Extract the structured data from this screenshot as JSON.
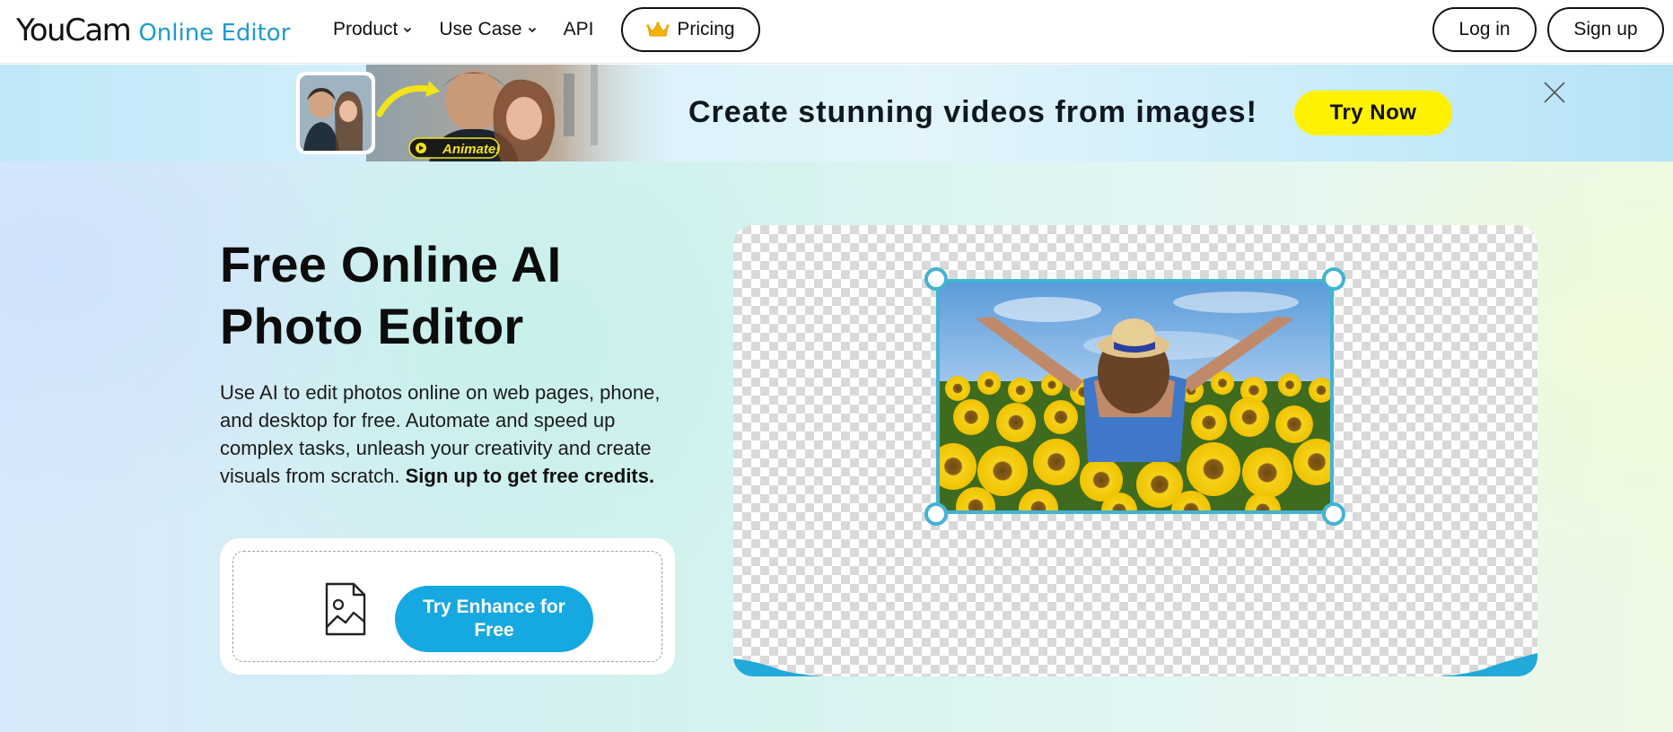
{
  "nav": {
    "logo_main": "YouCam",
    "logo_sub": "Online Editor",
    "menu": [
      {
        "label": "Product",
        "has_dropdown": true
      },
      {
        "label": "Use Case",
        "has_dropdown": true
      },
      {
        "label": "API",
        "has_dropdown": false
      }
    ],
    "pricing_label": "Pricing",
    "pricing_icon": "crown-icon",
    "login_label": "Log in",
    "signup_label": "Sign up"
  },
  "banner": {
    "art_badge": "Animate!",
    "title": "Create stunning videos from images!",
    "cta_label": "Try Now",
    "cta_color": "#fff200",
    "close_icon": "close-icon"
  },
  "hero": {
    "title_line1": "Free Online AI",
    "title_line2": "Photo Editor",
    "description": "Use AI to edit photos online on web pages, phone, and desktop for free. Automate and speed up complex tasks, unleash your creativity and create visuals from scratch.",
    "description_bold": "Sign up to get free credits.",
    "upload_icon": "image-file-icon",
    "enhance_button": "Try Enhance for Free",
    "accent_color": "#16a8e0"
  },
  "preview": {
    "image_icon": "sunflower-photo",
    "frame_color": "#43b3d3"
  }
}
